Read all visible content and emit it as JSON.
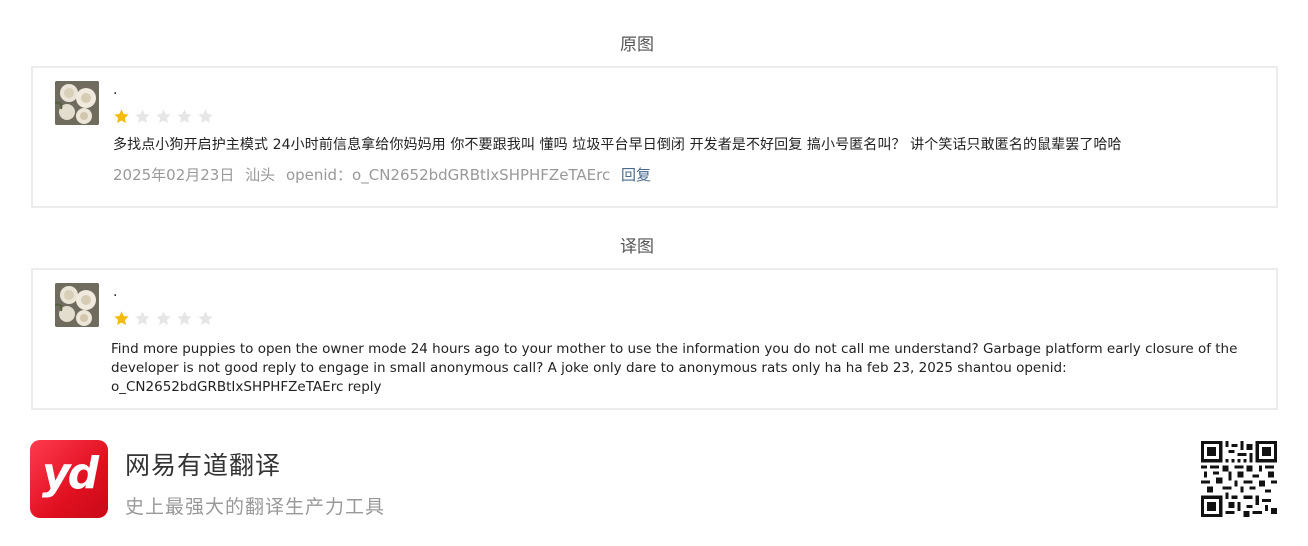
{
  "sections": {
    "original_title": "原图",
    "translated_title": "译图"
  },
  "original_review": {
    "user_name": ".",
    "rating": 1,
    "max_rating": 5,
    "comment": "多找点小狗开启护主模式   24小时前信息拿给你妈妈用   你不要跟我叫 懂吗   垃圾平台早日倒闭  开发者是不好回复 搞小号匿名叫？  讲个笑话只敢匿名的鼠辈罢了哈哈",
    "date": "2025年02月23日",
    "location": "汕头",
    "openid": "openid：o_CN2652bdGRBtIxSHPHFZeTAErc",
    "reply_label": "回复"
  },
  "translated_review": {
    "user_name": ".",
    "rating": 1,
    "max_rating": 5,
    "text": "Find more puppies to open the owner mode 24 hours ago to your mother to use the information you do not call me understand? Garbage platform early closure of the developer is not good reply to engage in small anonymous call? A joke only dare to anonymous rats only ha ha feb 23, 2025 shantou openid: o_CN2652bdGRBtIxSHPHFZeTAErc reply"
  },
  "footer": {
    "logo_text": "yd",
    "brand_name": "网易有道翻译",
    "slogan": "史上最强大的翻译生产力工具"
  },
  "colors": {
    "star_filled": "#f5b90f",
    "star_empty": "#e6e6e6",
    "brand_red": "#e01020",
    "reply_link": "#4a6b8f"
  }
}
